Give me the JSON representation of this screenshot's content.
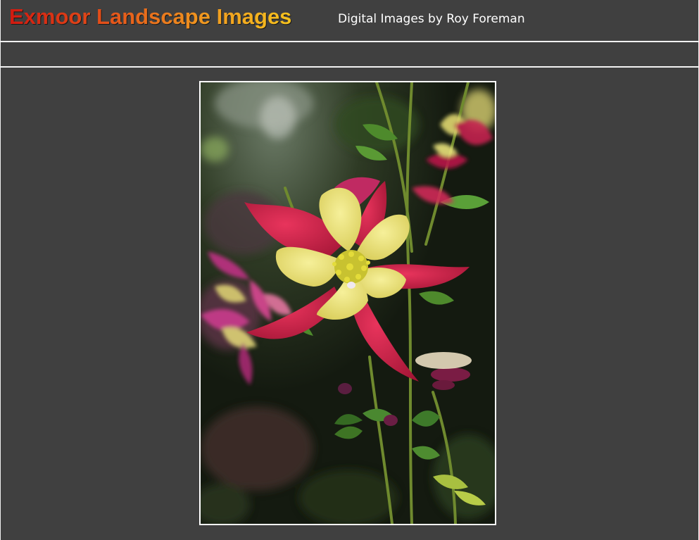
{
  "header": {
    "site_title": "Exmoor Landscape Images",
    "subtitle": "Digital Images by Roy Foreman"
  },
  "nav": {
    "items": []
  },
  "photo": {
    "subject": "flower-photo"
  },
  "colors": {
    "background": "#404040",
    "rule": "#f2f2f2",
    "title_gradient_start": "#d21a10",
    "title_gradient_end": "#f6c21e",
    "subtitle": "#ffffff"
  }
}
